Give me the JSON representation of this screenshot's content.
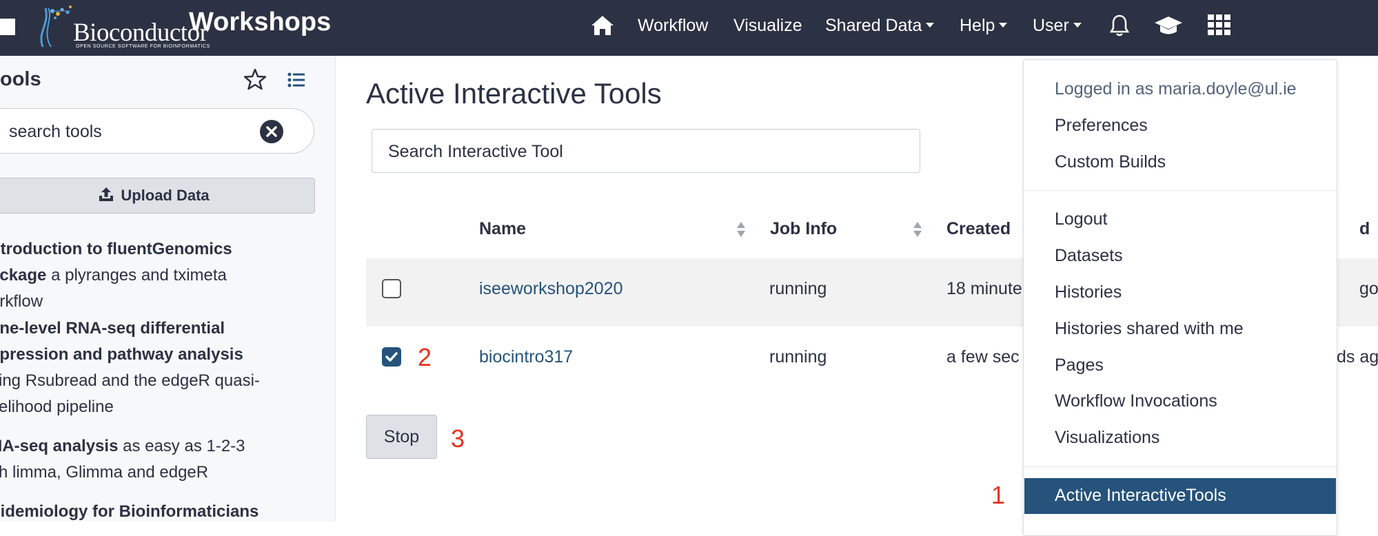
{
  "navbar": {
    "logo_text": "Bioconductor",
    "logo_subtext": "OPEN SOURCE SOFTWARE FOR BIOINFORMATICS",
    "brand_title": "Workshops",
    "home_icon": "home-icon",
    "items": [
      "Workflow",
      "Visualize",
      "Shared Data",
      "Help",
      "User"
    ],
    "bell_icon": "bell-icon",
    "cap_icon": "graduation-cap-icon",
    "grid_icon": "grid-icon"
  },
  "tool_panel": {
    "title": "ools",
    "search_placeholder": "search tools",
    "upload_label": "Upload Data",
    "workshops": [
      {
        "bold1": "ntroduction to fluentGenomics",
        "bold2": "ackage",
        "text2": " a plyranges and tximeta",
        "line3": "orkflow"
      },
      {
        "bold1": "ene-level RNA-seq differential",
        "bold2": "xpression and pathway analysis",
        "line3": "sing Rsubread and the edgeR quasi-",
        "line4": "kelihood pipeline"
      },
      {
        "bold1": "NA-seq analysis",
        "text1": " as easy as 1-2-3",
        "line2": "ith limma, Glimma and edgeR"
      },
      {
        "bold1": "pidemiology for Bioinformaticians"
      }
    ]
  },
  "main": {
    "title": "Active Interactive Tools",
    "search_placeholder": "Search Interactive Tool",
    "columns": {
      "name": "Name",
      "job_info": "Job Info",
      "created": "Created",
      "updated": "d"
    },
    "rows": [
      {
        "name": "iseeworkshop2020",
        "job_info": "running",
        "created": "18 minute",
        "updated": "go",
        "checked": false
      },
      {
        "name": "biocintro317",
        "job_info": "running",
        "created": "a few sec",
        "updated": "ds ago",
        "checked": true
      }
    ],
    "stop_label": "Stop",
    "steps": {
      "step1": "1",
      "step2": "2",
      "step3": "3"
    }
  },
  "user_menu": {
    "logged_in": "Logged in as maria.doyle@ul.ie",
    "items_top": [
      "Preferences",
      "Custom Builds"
    ],
    "items_mid": [
      "Logout",
      "Datasets",
      "Histories",
      "Histories shared with me",
      "Pages",
      "Workflow Invocations",
      "Visualizations"
    ],
    "active_item": "Active InteractiveTools"
  },
  "colors": {
    "navbar": "#2c3143",
    "link": "#25537b",
    "active": "#25537b",
    "step_marker": "#e8321e"
  }
}
